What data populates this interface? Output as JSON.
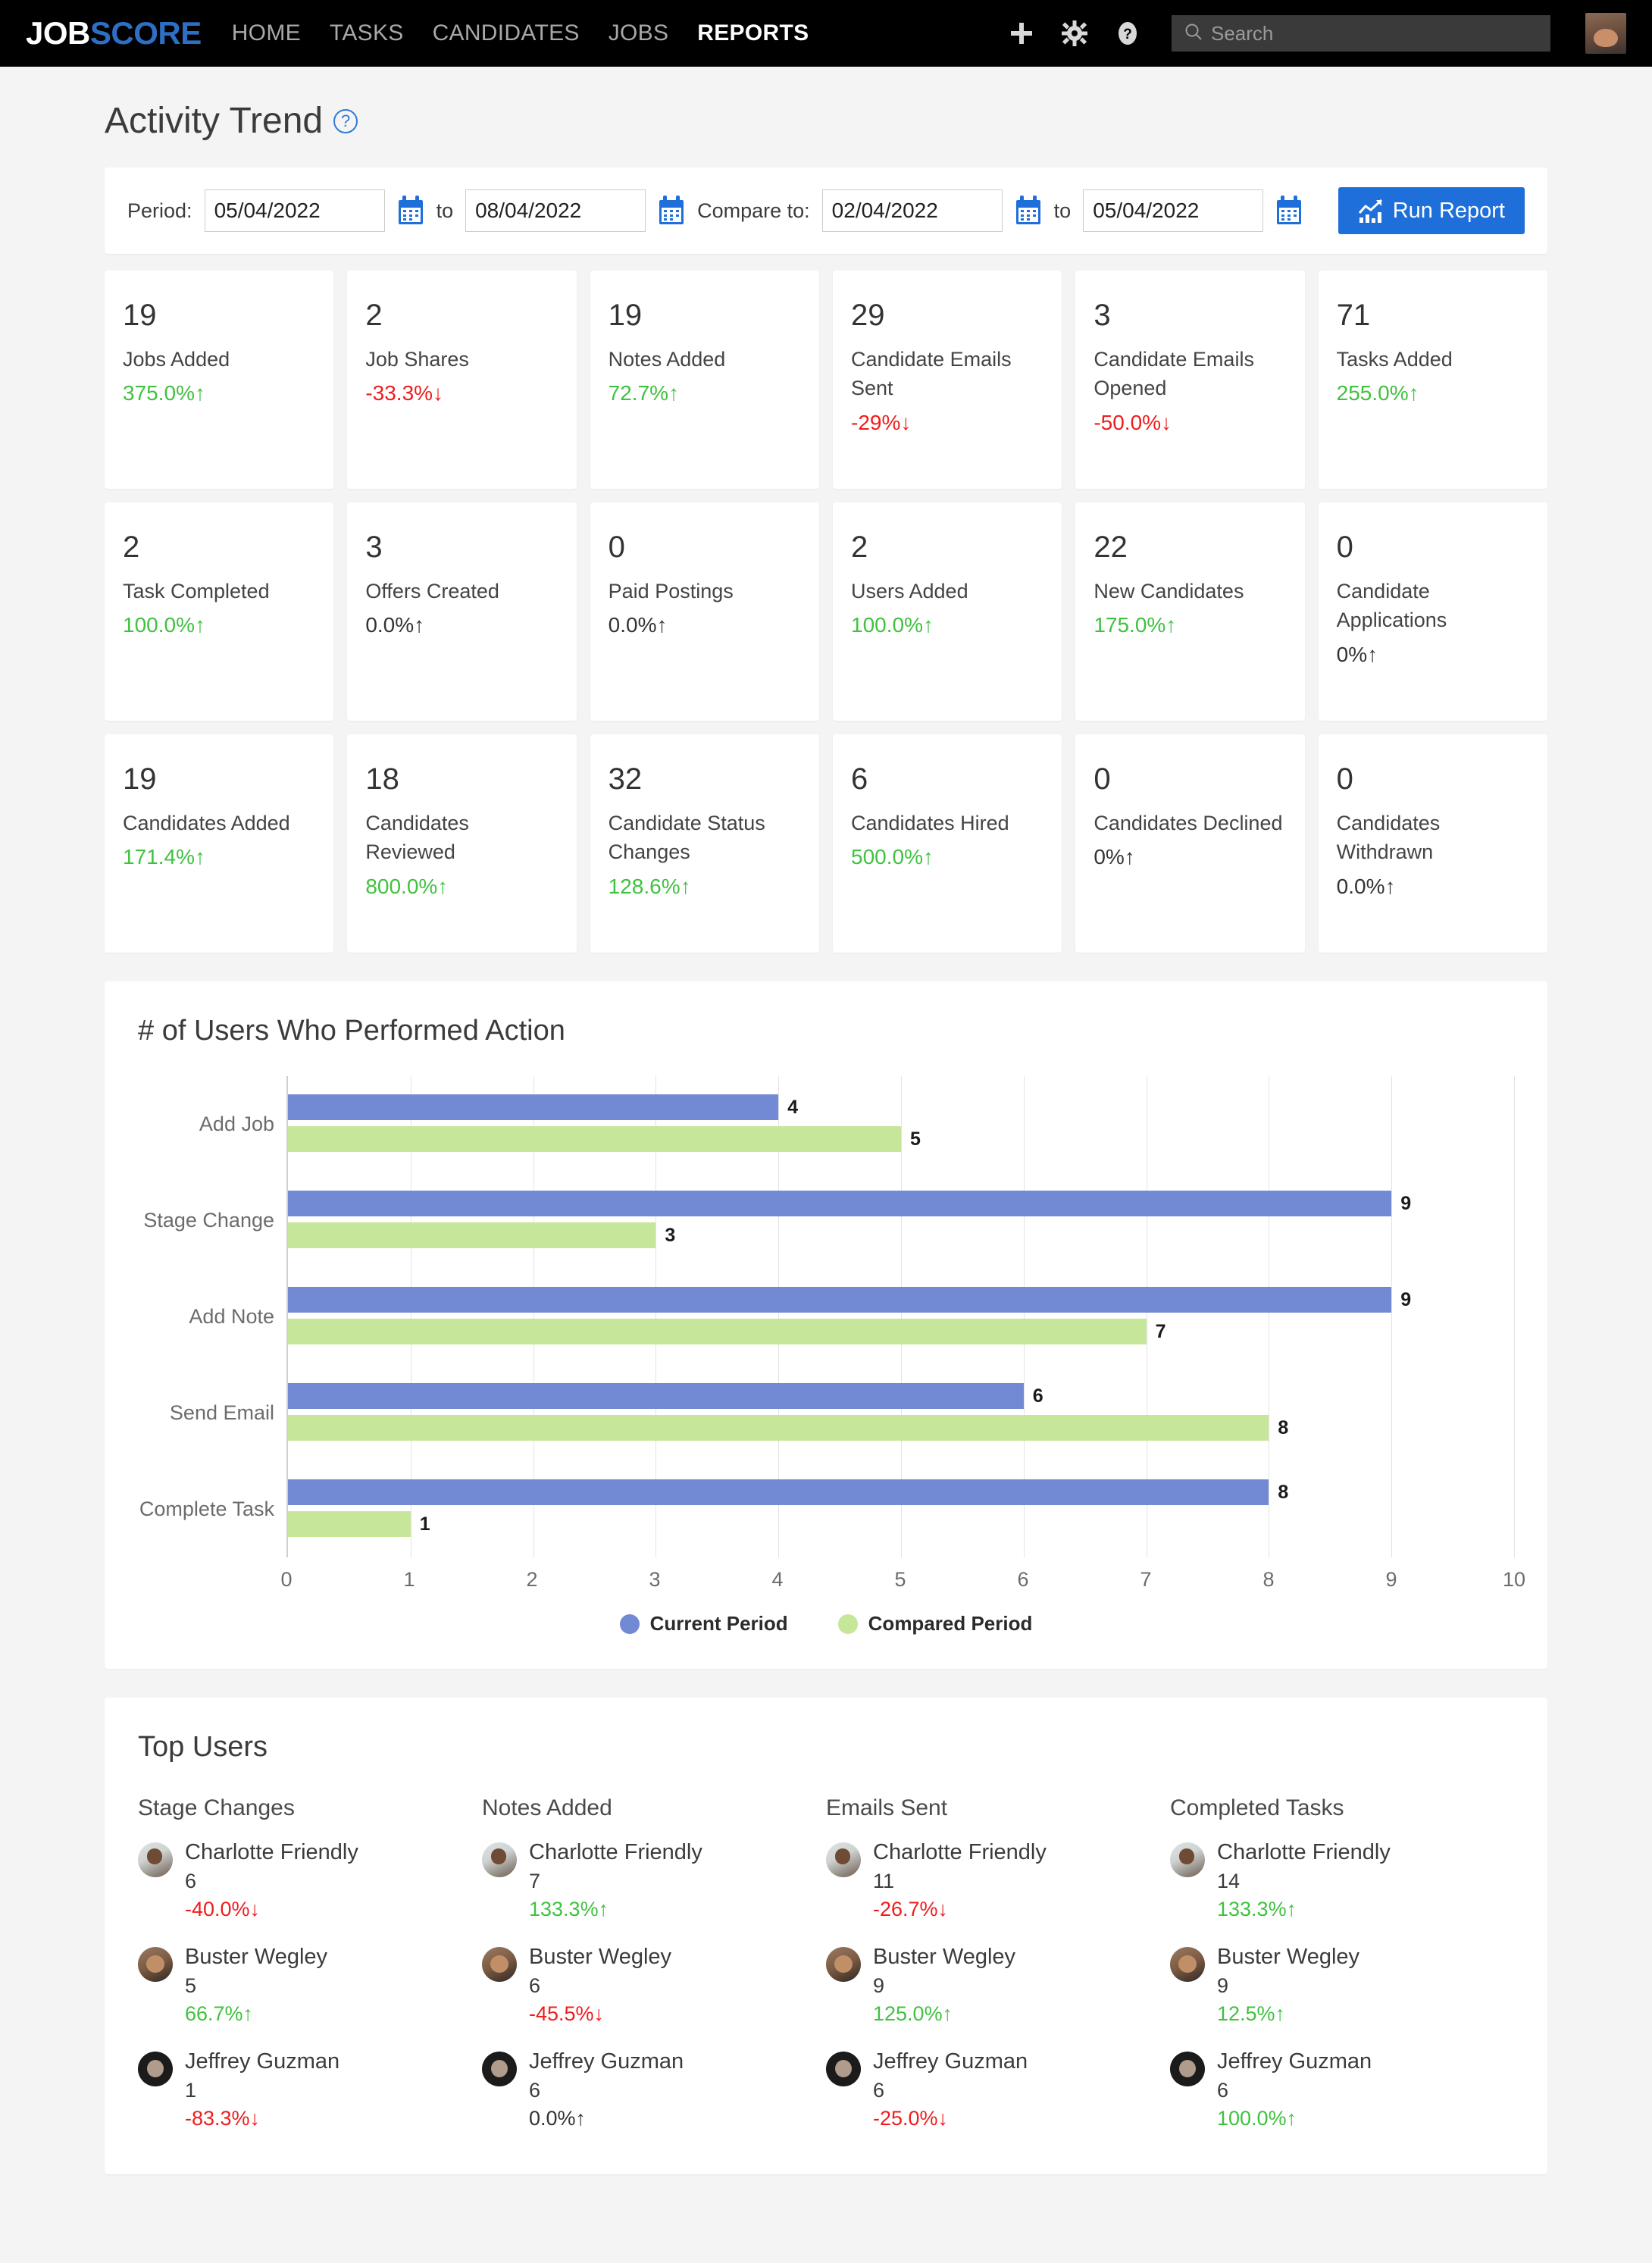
{
  "colors": {
    "brand_blue": "#2d6fc4",
    "accent_blue": "#1e6fd9",
    "up_green": "#3fc23f",
    "down_red": "#f01c1c",
    "series_current": "#7289d4",
    "series_compared": "#c6e69a"
  },
  "topnav": {
    "logo_part1": "JOB",
    "logo_part2": "SCORE",
    "links": [
      {
        "label": "HOME",
        "active": false
      },
      {
        "label": "TASKS",
        "active": false
      },
      {
        "label": "CANDIDATES",
        "active": false
      },
      {
        "label": "JOBS",
        "active": false
      },
      {
        "label": "REPORTS",
        "active": true
      }
    ],
    "icons": [
      "plus-icon",
      "gear-icon",
      "help-icon"
    ],
    "search_placeholder": "Search",
    "search_value": ""
  },
  "page": {
    "title": "Activity Trend",
    "help_glyph": "?"
  },
  "filterbar": {
    "period_label": "Period:",
    "period_start": "05/04/2022",
    "to_label_1": "to",
    "period_end": "08/04/2022",
    "compare_label": "Compare to:",
    "compare_start": "02/04/2022",
    "to_label_2": "to",
    "compare_end": "05/04/2022",
    "run_button": "Run Report"
  },
  "metrics": [
    {
      "value": "19",
      "label": "Jobs Added",
      "delta": "375.0%↑",
      "dir": "up"
    },
    {
      "value": "2",
      "label": "Job Shares",
      "delta": "-33.3%↓",
      "dir": "down"
    },
    {
      "value": "19",
      "label": "Notes Added",
      "delta": "72.7%↑",
      "dir": "up"
    },
    {
      "value": "29",
      "label": "Candidate Emails Sent",
      "delta": "-29%↓",
      "dir": "down"
    },
    {
      "value": "3",
      "label": "Candidate Emails Opened",
      "delta": "-50.0%↓",
      "dir": "down"
    },
    {
      "value": "71",
      "label": "Tasks Added",
      "delta": "255.0%↑",
      "dir": "up"
    },
    {
      "value": "2",
      "label": "Task Completed",
      "delta": "100.0%↑",
      "dir": "up"
    },
    {
      "value": "3",
      "label": "Offers Created",
      "delta": "0.0%↑",
      "dir": "flat"
    },
    {
      "value": "0",
      "label": "Paid Postings",
      "delta": "0.0%↑",
      "dir": "flat"
    },
    {
      "value": "2",
      "label": "Users Added",
      "delta": "100.0%↑",
      "dir": "up"
    },
    {
      "value": "22",
      "label": "New Candidates",
      "delta": "175.0%↑",
      "dir": "up"
    },
    {
      "value": "0",
      "label": "Candidate Applications",
      "delta": "0%↑",
      "dir": "flat"
    },
    {
      "value": "19",
      "label": "Candidates Added",
      "delta": "171.4%↑",
      "dir": "up"
    },
    {
      "value": "18",
      "label": "Candidates Reviewed",
      "delta": "800.0%↑",
      "dir": "up"
    },
    {
      "value": "32",
      "label": "Candidate Status Changes",
      "delta": "128.6%↑",
      "dir": "up"
    },
    {
      "value": "6",
      "label": "Candidates Hired",
      "delta": "500.0%↑",
      "dir": "up"
    },
    {
      "value": "0",
      "label": "Candidates Declined",
      "delta": "0%↑",
      "dir": "flat"
    },
    {
      "value": "0",
      "label": "Candidates Withdrawn",
      "delta": "0.0%↑",
      "dir": "flat"
    }
  ],
  "chart_data": {
    "type": "bar",
    "orientation": "horizontal",
    "title": "# of Users Who Performed Action",
    "xlabel": "",
    "ylabel": "",
    "categories": [
      "Add Job",
      "Stage Change",
      "Add Note",
      "Send Email",
      "Complete Task"
    ],
    "series": [
      {
        "name": "Current Period",
        "color": "#7289d4",
        "values": [
          4,
          9,
          9,
          6,
          8
        ]
      },
      {
        "name": "Compared Period",
        "color": "#c6e69a",
        "values": [
          5,
          3,
          7,
          8,
          1
        ]
      }
    ],
    "xlim": [
      0,
      10
    ],
    "xticks": [
      0,
      1,
      2,
      3,
      4,
      5,
      6,
      7,
      8,
      9,
      10
    ],
    "grid": true,
    "legend_position": "bottom",
    "data_labels": true
  },
  "top_users": {
    "section_title": "Top Users",
    "columns": [
      {
        "title": "Stage Changes",
        "rows": [
          {
            "avatar": "charlotte",
            "name": "Charlotte Friendly",
            "count": "6",
            "delta": "-40.0%↓",
            "dir": "down"
          },
          {
            "avatar": "buster",
            "name": "Buster Wegley",
            "count": "5",
            "delta": "66.7%↑",
            "dir": "up"
          },
          {
            "avatar": "jeffrey",
            "name": "Jeffrey Guzman",
            "count": "1",
            "delta": "-83.3%↓",
            "dir": "down"
          }
        ]
      },
      {
        "title": "Notes Added",
        "rows": [
          {
            "avatar": "charlotte",
            "name": "Charlotte Friendly",
            "count": "7",
            "delta": "133.3%↑",
            "dir": "up"
          },
          {
            "avatar": "buster",
            "name": "Buster Wegley",
            "count": "6",
            "delta": "-45.5%↓",
            "dir": "down"
          },
          {
            "avatar": "jeffrey",
            "name": "Jeffrey Guzman",
            "count": "6",
            "delta": "0.0%↑",
            "dir": "flat"
          }
        ]
      },
      {
        "title": "Emails Sent",
        "rows": [
          {
            "avatar": "charlotte",
            "name": "Charlotte Friendly",
            "count": "11",
            "delta": "-26.7%↓",
            "dir": "down"
          },
          {
            "avatar": "buster",
            "name": "Buster Wegley",
            "count": "9",
            "delta": "125.0%↑",
            "dir": "up"
          },
          {
            "avatar": "jeffrey",
            "name": "Jeffrey Guzman",
            "count": "6",
            "delta": "-25.0%↓",
            "dir": "down"
          }
        ]
      },
      {
        "title": "Completed Tasks",
        "rows": [
          {
            "avatar": "charlotte",
            "name": "Charlotte Friendly",
            "count": "14",
            "delta": "133.3%↑",
            "dir": "up"
          },
          {
            "avatar": "buster",
            "name": "Buster Wegley",
            "count": "9",
            "delta": "12.5%↑",
            "dir": "up"
          },
          {
            "avatar": "jeffrey",
            "name": "Jeffrey Guzman",
            "count": "6",
            "delta": "100.0%↑",
            "dir": "up"
          }
        ]
      }
    ]
  }
}
